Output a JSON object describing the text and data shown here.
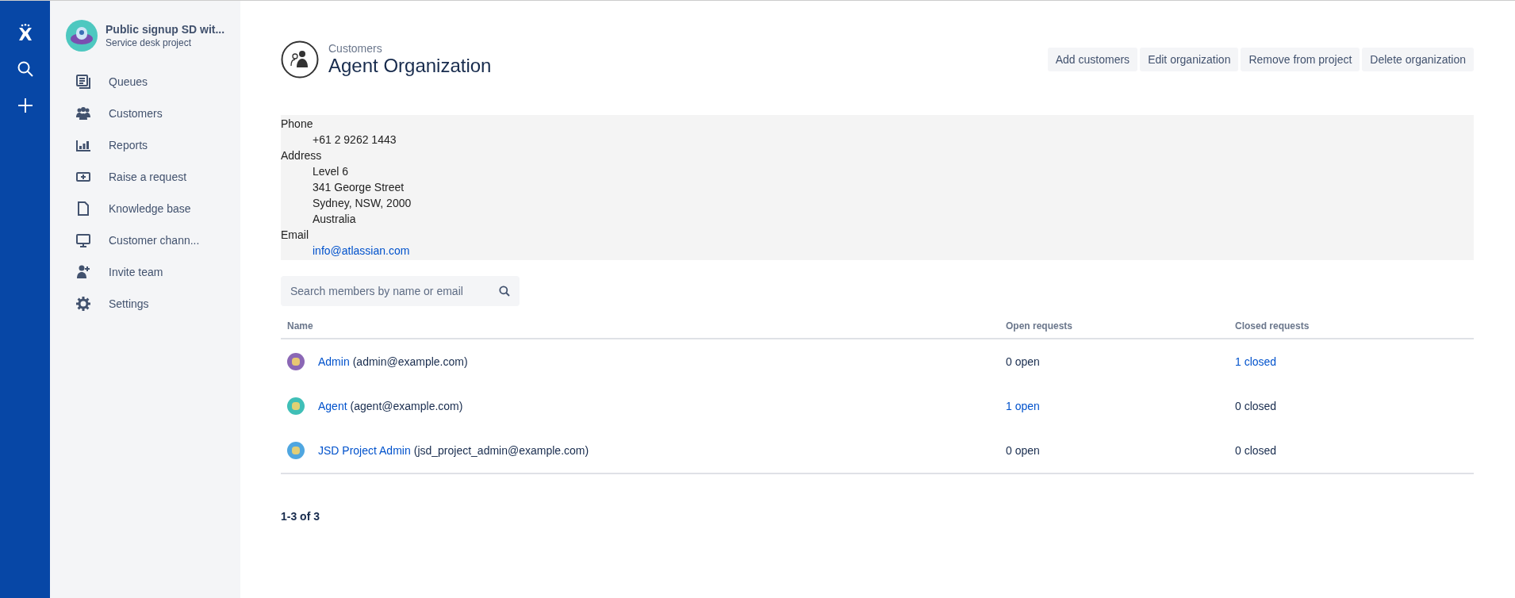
{
  "project": {
    "name": "Public signup SD wit...",
    "type": "Service desk project"
  },
  "nav": [
    {
      "label": "Queues"
    },
    {
      "label": "Customers"
    },
    {
      "label": "Reports"
    },
    {
      "label": "Raise a request"
    },
    {
      "label": "Knowledge base"
    },
    {
      "label": "Customer chann..."
    },
    {
      "label": "Invite team"
    },
    {
      "label": "Settings"
    }
  ],
  "header": {
    "breadcrumb": "Customers",
    "title": "Agent Organization"
  },
  "actions": [
    "Add customers",
    "Edit organization",
    "Remove from project",
    "Delete organization"
  ],
  "details": [
    {
      "label": "Phone",
      "lines": [
        {
          "text": "+61 2 9262 1443",
          "link": false
        }
      ]
    },
    {
      "label": "Address",
      "lines": [
        {
          "text": "Level 6",
          "link": false
        },
        {
          "text": "341 George Street",
          "link": false
        },
        {
          "text": "Sydney, NSW, 2000",
          "link": false
        },
        {
          "text": "Australia",
          "link": false
        }
      ]
    },
    {
      "label": "Email",
      "lines": [
        {
          "text": "info@atlassian.com",
          "link": true
        }
      ]
    }
  ],
  "search": {
    "placeholder": "Search members by name or email"
  },
  "table": {
    "columns": [
      "Name",
      "Open requests",
      "Closed requests"
    ],
    "rows": [
      {
        "color": "#8b67b5",
        "name": "Admin",
        "email": "(admin@example.com)",
        "open": {
          "text": "0 open",
          "link": false
        },
        "closed": {
          "text": "1 closed",
          "link": true
        }
      },
      {
        "color": "#3fbfb7",
        "name": "Agent",
        "email": "(agent@example.com)",
        "open": {
          "text": "1 open",
          "link": true
        },
        "closed": {
          "text": "0 closed",
          "link": false
        }
      },
      {
        "color": "#4fa6e0",
        "name": "JSD Project Admin",
        "email": "(jsd_project_admin@example.com)",
        "open": {
          "text": "0 open",
          "link": false
        },
        "closed": {
          "text": "0 closed",
          "link": false
        }
      }
    ]
  },
  "pagination": "1-3 of 3"
}
